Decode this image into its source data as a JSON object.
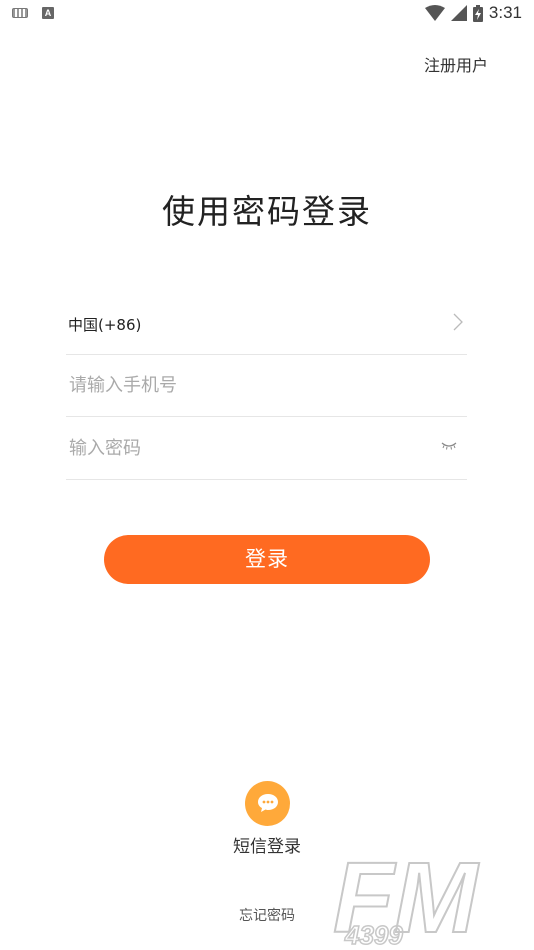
{
  "status_bar": {
    "time": "3:31",
    "icons": [
      "keyboard-icon",
      "a-notification-icon",
      "wifi-icon",
      "cell-signal-icon",
      "battery-charging-icon"
    ]
  },
  "header": {
    "register_label": "注册用户"
  },
  "page_title": "使用密码登录",
  "form": {
    "country_label": "中国(+86)",
    "phone_placeholder": "请输入手机号",
    "phone_value": "",
    "password_placeholder": "输入密码",
    "password_value": ""
  },
  "login_button_label": "登录",
  "sms_login": {
    "label": "短信登录",
    "icon": "chat-bubble-icon"
  },
  "forgot_password_label": "忘记密码",
  "watermark": {
    "text_large": "FM",
    "text_small": "4399"
  },
  "colors": {
    "accent": "#ff6a21",
    "sms_icon_bg": "#ffa93a"
  }
}
